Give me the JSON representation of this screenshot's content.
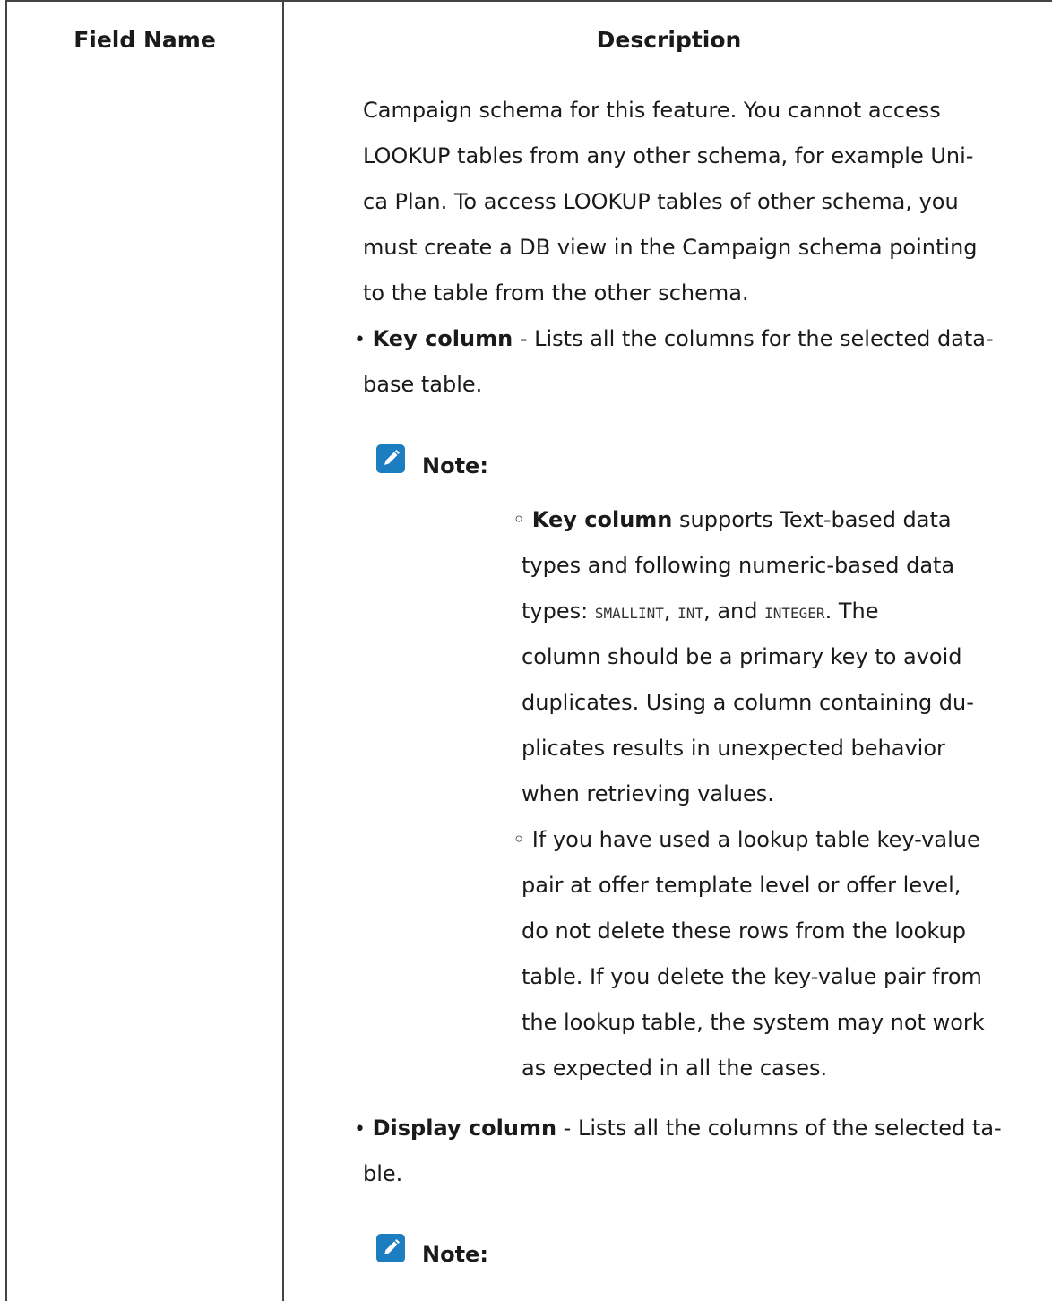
{
  "table": {
    "headers": {
      "field_name": "Field Name",
      "description": "Description"
    }
  },
  "description": {
    "intro_lines": [
      "Campaign schema for this feature. You cannot access",
      "LOOKUP tables from any other schema, for example Uni-",
      "ca Plan. To access LOOKUP tables of other schema, you",
      "must create a DB view in the Campaign schema pointing",
      "to the table from the other schema."
    ],
    "key_column": {
      "term": "Key column",
      "rest_line1": " - Lists all the columns for the selected data-",
      "line2": "base table."
    },
    "note1": {
      "label": "Note:",
      "item1": {
        "term": "Key column",
        "l1_rest": " supports Text-based data",
        "l2": "types and following numeric-based data",
        "l3_prefix": "types: ",
        "code1": "SMALLINT",
        "sep1": ", ",
        "code2": "INT",
        "sep2": ", and ",
        "code3": "INTEGER",
        "l3_suffix": ". The",
        "l4": "column should be a primary key to avoid",
        "l5": "duplicates. Using a column containing du-",
        "l6": "plicates results in unexpected behavior",
        "l7": "when retrieving values."
      },
      "item2": {
        "l1": "If you have used a lookup table key-value",
        "l2": "pair at offer template level or offer level,",
        "l3": "do not delete these rows from the lookup",
        "l4": "table. If you delete the key-value pair from",
        "l5": "the lookup table, the system may not work",
        "l6": "as expected in all the cases."
      }
    },
    "display_column": {
      "term": "Display column",
      "rest_line1": " - Lists all the columns of the selected ta-",
      "line2": "ble."
    },
    "note2": {
      "label": "Note:"
    },
    "bullet_char": "•",
    "sub_bullet_char": "◦",
    "accent_color": "#1d7dc1",
    "note_icon": "pencil-icon"
  }
}
